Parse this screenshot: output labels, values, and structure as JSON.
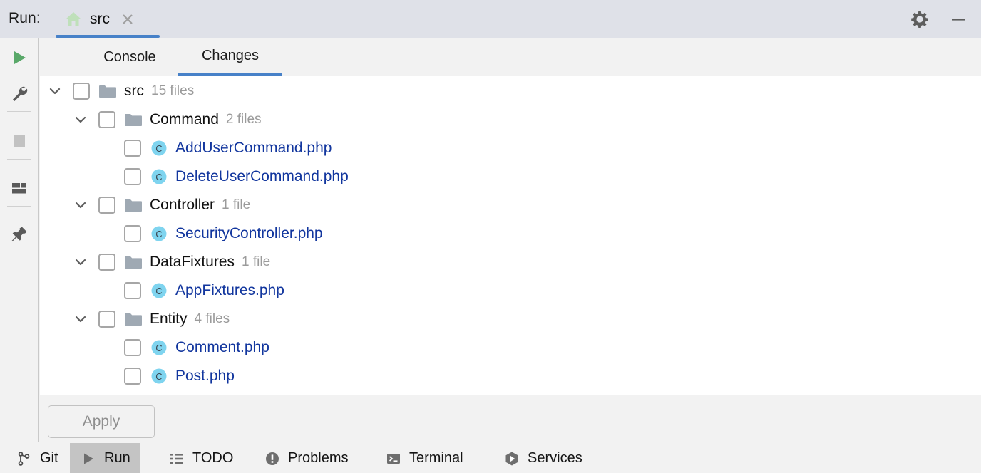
{
  "titlebar": {
    "run_label": "Run:",
    "tab": {
      "title": "src",
      "icon": "home-icon",
      "close_icon": "close-icon"
    },
    "actions": [
      {
        "name": "settings-button",
        "icon": "gear-icon"
      },
      {
        "name": "minimize-button",
        "icon": "minimize-icon"
      }
    ],
    "accent_color": "#4781c8",
    "background": "#dfe1e8"
  },
  "rail": {
    "items": [
      {
        "name": "rerun-button",
        "icon": "play-icon",
        "color": "#59a869"
      },
      {
        "name": "settings-button",
        "icon": "wrench-icon",
        "color": "#5a5a5a"
      },
      {
        "name": "stop-button",
        "icon": "stop-square-icon",
        "color": "#c2c2c2"
      },
      {
        "name": "layout-button",
        "icon": "layout-grid-icon",
        "color": "#5a5a5a"
      },
      {
        "name": "pin-button",
        "icon": "pin-icon",
        "color": "#5a5a5a"
      }
    ]
  },
  "tabs": [
    {
      "label": "Console",
      "active": false
    },
    {
      "label": "Changes",
      "active": true
    }
  ],
  "tree": {
    "rows": [
      {
        "type": "folder",
        "depth": 0,
        "name": "src",
        "count": "15 files",
        "expanded": true,
        "checked": false
      },
      {
        "type": "folder",
        "depth": 1,
        "name": "Command",
        "count": "2 files",
        "expanded": true,
        "checked": false
      },
      {
        "type": "file",
        "depth": 2,
        "name": "AddUserCommand.php",
        "icon": "php-class-icon",
        "checked": false
      },
      {
        "type": "file",
        "depth": 2,
        "name": "DeleteUserCommand.php",
        "icon": "php-class-icon",
        "checked": false
      },
      {
        "type": "folder",
        "depth": 1,
        "name": "Controller",
        "count": "1 file",
        "expanded": true,
        "checked": false
      },
      {
        "type": "file",
        "depth": 2,
        "name": "SecurityController.php",
        "icon": "php-class-icon",
        "checked": false
      },
      {
        "type": "folder",
        "depth": 1,
        "name": "DataFixtures",
        "count": "1 file",
        "expanded": true,
        "checked": false
      },
      {
        "type": "file",
        "depth": 2,
        "name": "AppFixtures.php",
        "icon": "php-class-icon",
        "checked": false
      },
      {
        "type": "folder",
        "depth": 1,
        "name": "Entity",
        "count": "4 files",
        "expanded": true,
        "checked": false
      },
      {
        "type": "file",
        "depth": 2,
        "name": "Comment.php",
        "icon": "php-class-icon",
        "checked": false
      },
      {
        "type": "file",
        "depth": 2,
        "name": "Post.php",
        "icon": "php-class-icon",
        "checked": false
      }
    ],
    "folder_color": "#9fa9b3",
    "file_link_color": "#12369e",
    "class_icon_color": "#7fd4ef"
  },
  "apply": {
    "label": "Apply",
    "enabled": false
  },
  "statusbar": {
    "items": [
      {
        "label": "Git",
        "icon": "git-branch-icon",
        "active": false
      },
      {
        "label": "Run",
        "icon": "play-icon",
        "active": true
      },
      {
        "label": "TODO",
        "icon": "todo-list-icon",
        "active": false
      },
      {
        "label": "Problems",
        "icon": "problem-exclamation-icon",
        "active": false
      },
      {
        "label": "Terminal",
        "icon": "terminal-icon",
        "active": false
      },
      {
        "label": "Services",
        "icon": "services-hexagon-icon",
        "active": false
      }
    ],
    "active_background": "#c4c4c4"
  }
}
